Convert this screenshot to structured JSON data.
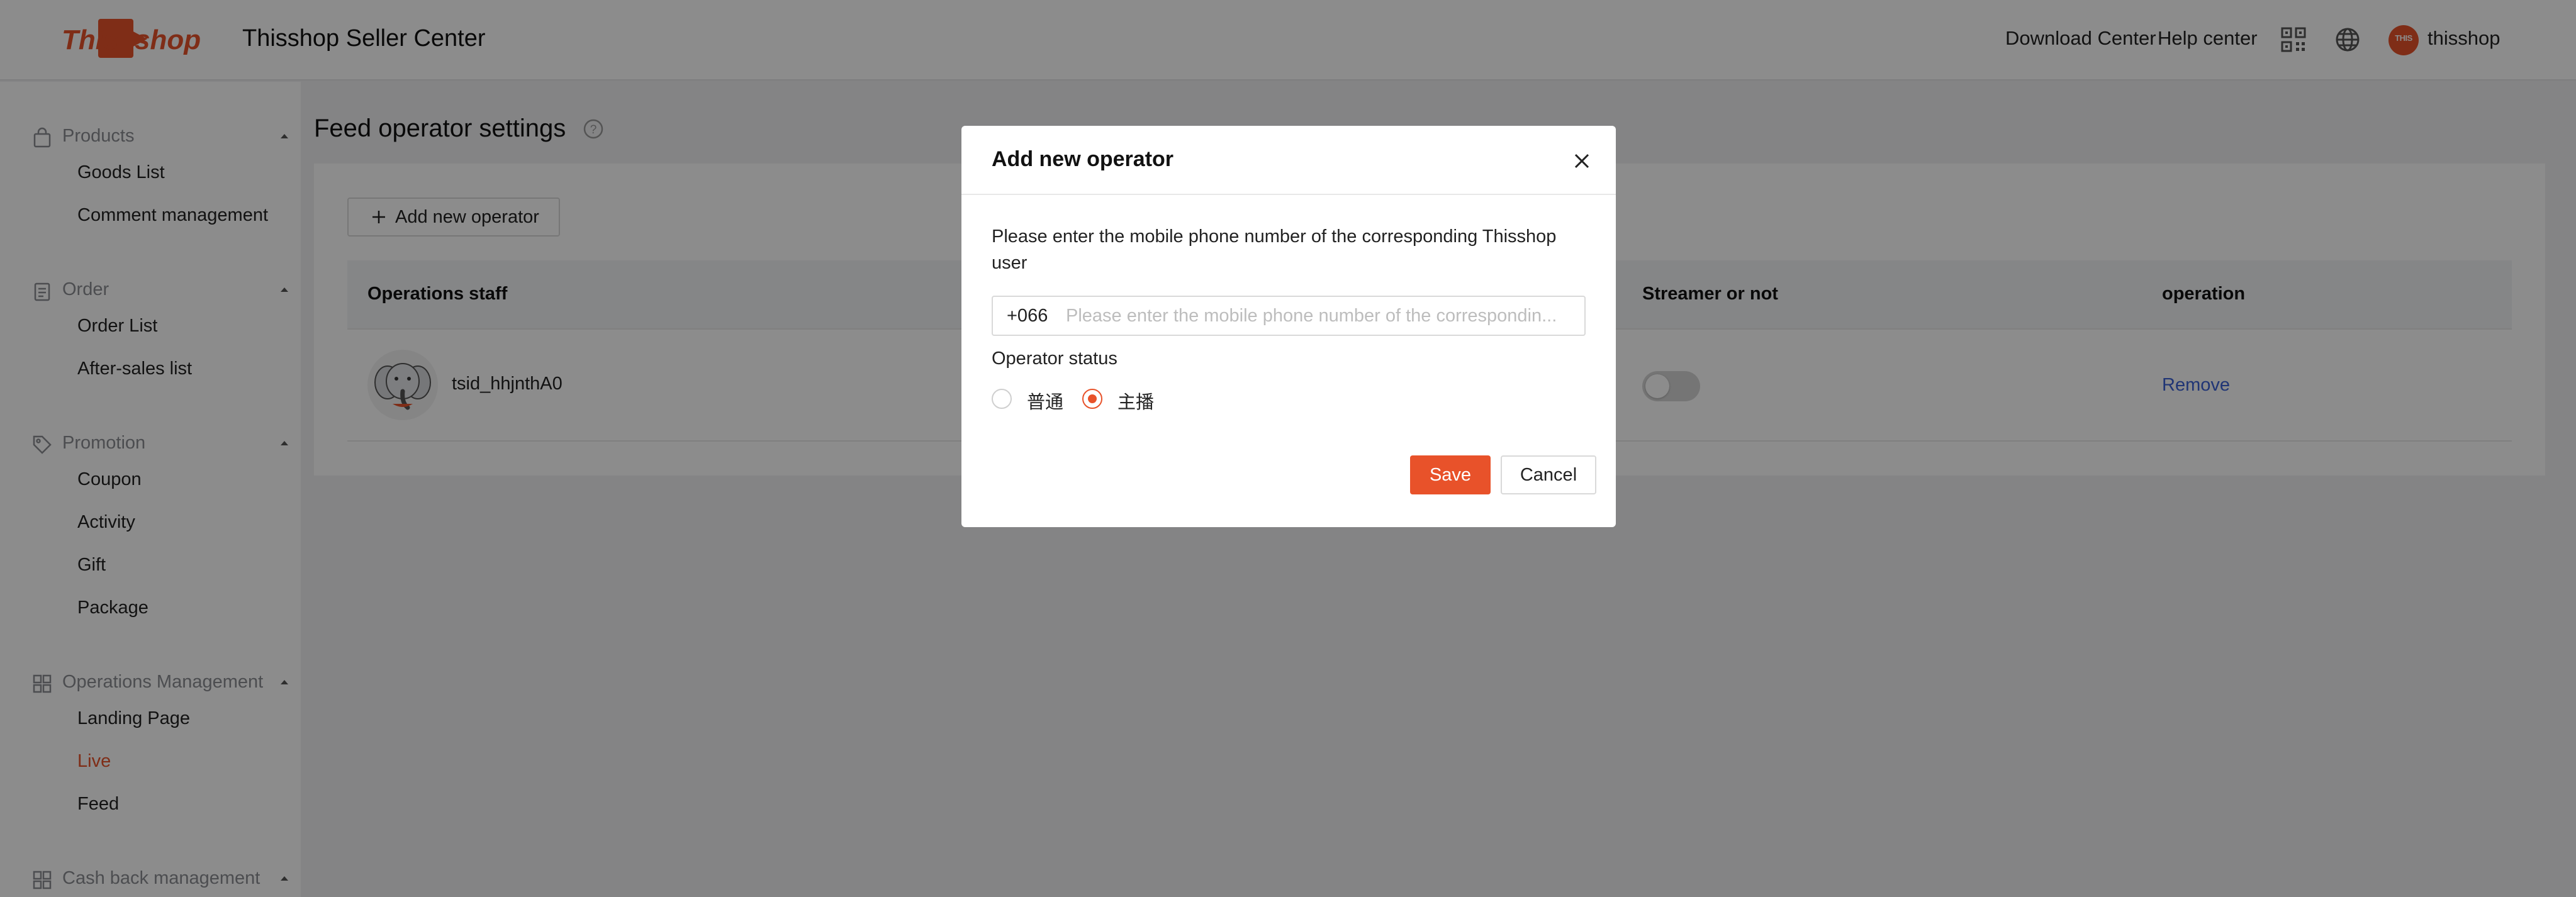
{
  "header": {
    "app_title": "Thisshop Seller Center",
    "logo_text": "This shop",
    "download_center": "Download Center",
    "help_center": "Help center",
    "user_name": "thisshop",
    "avatar_text": "THIS"
  },
  "sidebar": {
    "sections": [
      {
        "label": "Products",
        "icon": "bag-icon",
        "items": [
          "Goods List",
          "Comment management"
        ]
      },
      {
        "label": "Order",
        "icon": "clipboard-icon",
        "items": [
          "Order List",
          "After-sales list"
        ]
      },
      {
        "label": "Promotion",
        "icon": "tag-icon",
        "items": [
          "Coupon",
          "Activity",
          "Gift",
          "Package"
        ]
      },
      {
        "label": "Operations Management",
        "icon": "grid-icon",
        "items": [
          "Landing Page",
          "Live",
          "Feed"
        ]
      },
      {
        "label": "Cash back management",
        "icon": "grid-icon",
        "items": []
      }
    ],
    "active_item": "Live",
    "active_color": "#e8522a"
  },
  "main": {
    "page_title": "Feed operator settings",
    "add_button": "Add new operator",
    "table": {
      "columns": [
        "Operations staff",
        "Streamer or not",
        "operation"
      ],
      "rows": [
        {
          "name": "tsid_hhjnthA0",
          "streamer": false,
          "action": "Remove"
        }
      ]
    }
  },
  "modal": {
    "title": "Add new operator",
    "description": "Please enter the mobile phone number of the corresponding Thisshop user",
    "phone_prefix": "+066",
    "phone_placeholder": "Please enter the mobile phone number of the correspondin...",
    "phone_value": "",
    "status_label": "Operator status",
    "status_options": [
      "普通",
      "主播"
    ],
    "status_selected": "主播",
    "save": "Save",
    "cancel": "Cancel"
  },
  "colors": {
    "accent": "#e8522a",
    "link": "#3b62d6"
  }
}
